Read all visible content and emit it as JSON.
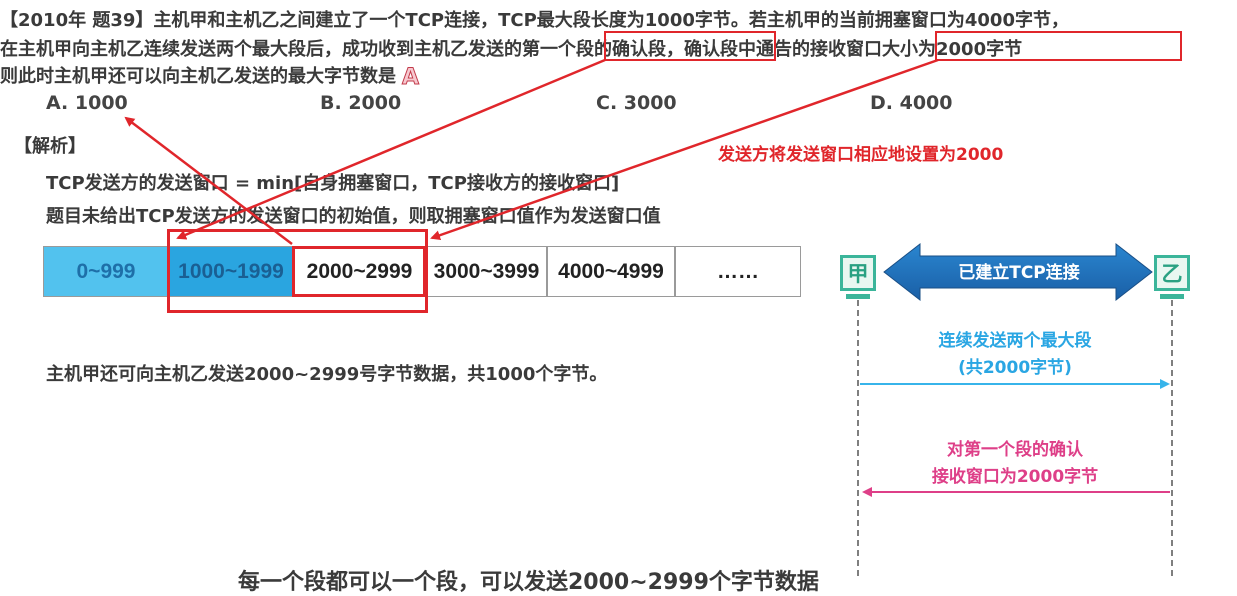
{
  "question": {
    "line1": "【2010年 题39】主机甲和主机乙之间建立了一个TCP连接，TCP最大段长度为1000字节。若主机甲的当前拥塞窗口为4000字节，",
    "line2_pre": "在主机甲向主机乙连续发送两个最大段后，成功收到主机乙发送的",
    "line2_hl1": "第一个段的确认段",
    "line2_mid": "，确认段中通告的",
    "line2_hl2": "接收窗口大小为2000字节",
    "line3": "则此时主机甲还可以向主机乙发送的最大字节数是",
    "answer": "A"
  },
  "options": [
    "A. 1000",
    "B. 2000",
    "C. 3000",
    "D. 4000"
  ],
  "analysis": {
    "heading": "【解析】",
    "line1": "TCP发送方的发送窗口 = min[自身拥塞窗口，TCP接收方的接收窗口]",
    "line2": "题目未给出TCP发送方的发送窗口的初始值，则取拥塞窗口值作为发送窗口值",
    "red_note": "发送方将发送窗口相应地设置为2000",
    "conclusion": "主机甲还可向主机乙发送2000~2999号字节数据，共1000个字节。",
    "cut_text": "每一个段都可以一个段，可以发送2000~2999个字节数据"
  },
  "sequence": [
    "0~999",
    "1000~1999",
    "2000~2999",
    "3000~3999",
    "4000~4999",
    "……"
  ],
  "diagram": {
    "host_a": "甲",
    "host_b": "乙",
    "connection": "已建立TCP连接",
    "send_note_1": "连续发送两个最大段",
    "send_note_2": "(共2000字节)",
    "ack_note_1": "对第一个段的确认",
    "ack_note_2": "接收窗口为2000字节"
  },
  "colors": {
    "highlight_red": "#e0262b",
    "sent_blue": "#52c2ee",
    "window_blue": "#2aa5e0",
    "host_green": "#3bb59a",
    "arrow_blue": "#1f7fc4",
    "note_pink": "#de3f88"
  }
}
